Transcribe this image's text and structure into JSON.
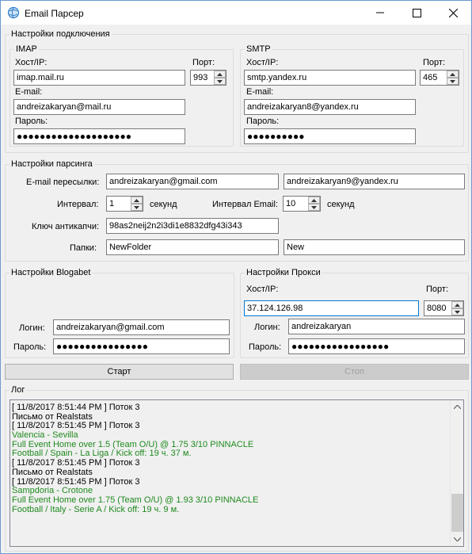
{
  "window": {
    "title": "Email Парсер"
  },
  "connection": {
    "title": "Настройки подключения",
    "imap": {
      "title": "IMAP",
      "host_label": "Хост/IP:",
      "host": "imap.mail.ru",
      "port_label": "Порт:",
      "port": "993",
      "email_label": "E-mail:",
      "email": "andreizakaryan@mail.ru",
      "password_label": "Пароль:",
      "password": "●●●●●●●●●●●●●●●●●●●●"
    },
    "smtp": {
      "title": "SMTP",
      "host_label": "Хост/IP:",
      "host": "smtp.yandex.ru",
      "port_label": "Порт:",
      "port": "465",
      "email_label": "E-mail:",
      "email": "andreizakaryan8@yandex.ru",
      "password_label": "Пароль:",
      "password": "●●●●●●●●●●"
    }
  },
  "parsing": {
    "title": "Настройки парсинга",
    "forward_label": "E-mail пересылки:",
    "forward_1": "andreizakaryan@gmail.com",
    "forward_2": "andreizakaryan9@yandex.ru",
    "interval_label": "Интервал:",
    "interval": "1",
    "seconds_label_1": "секунд",
    "email_interval_label": "Интервал Email:",
    "email_interval": "10",
    "seconds_label_2": "секунд",
    "captcha_label": "Ключ антикапчи:",
    "captcha_key": "98as2neij2n2i3di1e8832dfg43i343",
    "folders_label": "Папки:",
    "folder_1": "NewFolder",
    "folder_2": "New"
  },
  "blogabet": {
    "title": "Настройки Blogabet",
    "login_label": "Логин:",
    "login": "andreizakaryan@gmail.com",
    "password_label": "Пароль:",
    "password": "●●●●●●●●●●●●●●●●"
  },
  "proxy": {
    "title": "Настройки Прокси",
    "host_label": "Хост/IP:",
    "host": "37.124.126.98",
    "port_label": "Порт:",
    "port": "8080",
    "login_label": "Логин:",
    "login": "andreizakaryan",
    "password_label": "Пароль:",
    "password": "●●●●●●●●●●●●●●●●●"
  },
  "actions": {
    "start_label": "Старт",
    "stop_label": "Стоп"
  },
  "log": {
    "title": "Лог",
    "lines": [
      {
        "text": "[ 11/8/2017 8:51:44 PM ] Поток 3",
        "color": "black"
      },
      {
        "text": "Письмо от Realstats",
        "color": "black"
      },
      {
        "text": "[ 11/8/2017 8:51:45 PM ] Поток 3",
        "color": "black"
      },
      {
        "text": "Valencia - Sevilla",
        "color": "green"
      },
      {
        "text": "Full Event Home over 1.5 (Team O/U) @ 1.75 3/10 PINNACLE",
        "color": "green"
      },
      {
        "text": "Football / Spain - La Liga / Kick off: 19 ч. 37 м.",
        "color": "green"
      },
      {
        "text": "[ 11/8/2017 8:51:45 PM ] Поток 3",
        "color": "black"
      },
      {
        "text": "Письмо от Realstats",
        "color": "black"
      },
      {
        "text": "[ 11/8/2017 8:51:45 PM ] Поток 3",
        "color": "black"
      },
      {
        "text": "Sampdoria - Crotone",
        "color": "green"
      },
      {
        "text": "Full Event Home over 1.75 (Team O/U) @ 1.93 3/10 PINNACLE",
        "color": "green"
      },
      {
        "text": "Football / Italy - Serie A / Kick off: 19 ч. 9 м.",
        "color": "green"
      }
    ]
  }
}
